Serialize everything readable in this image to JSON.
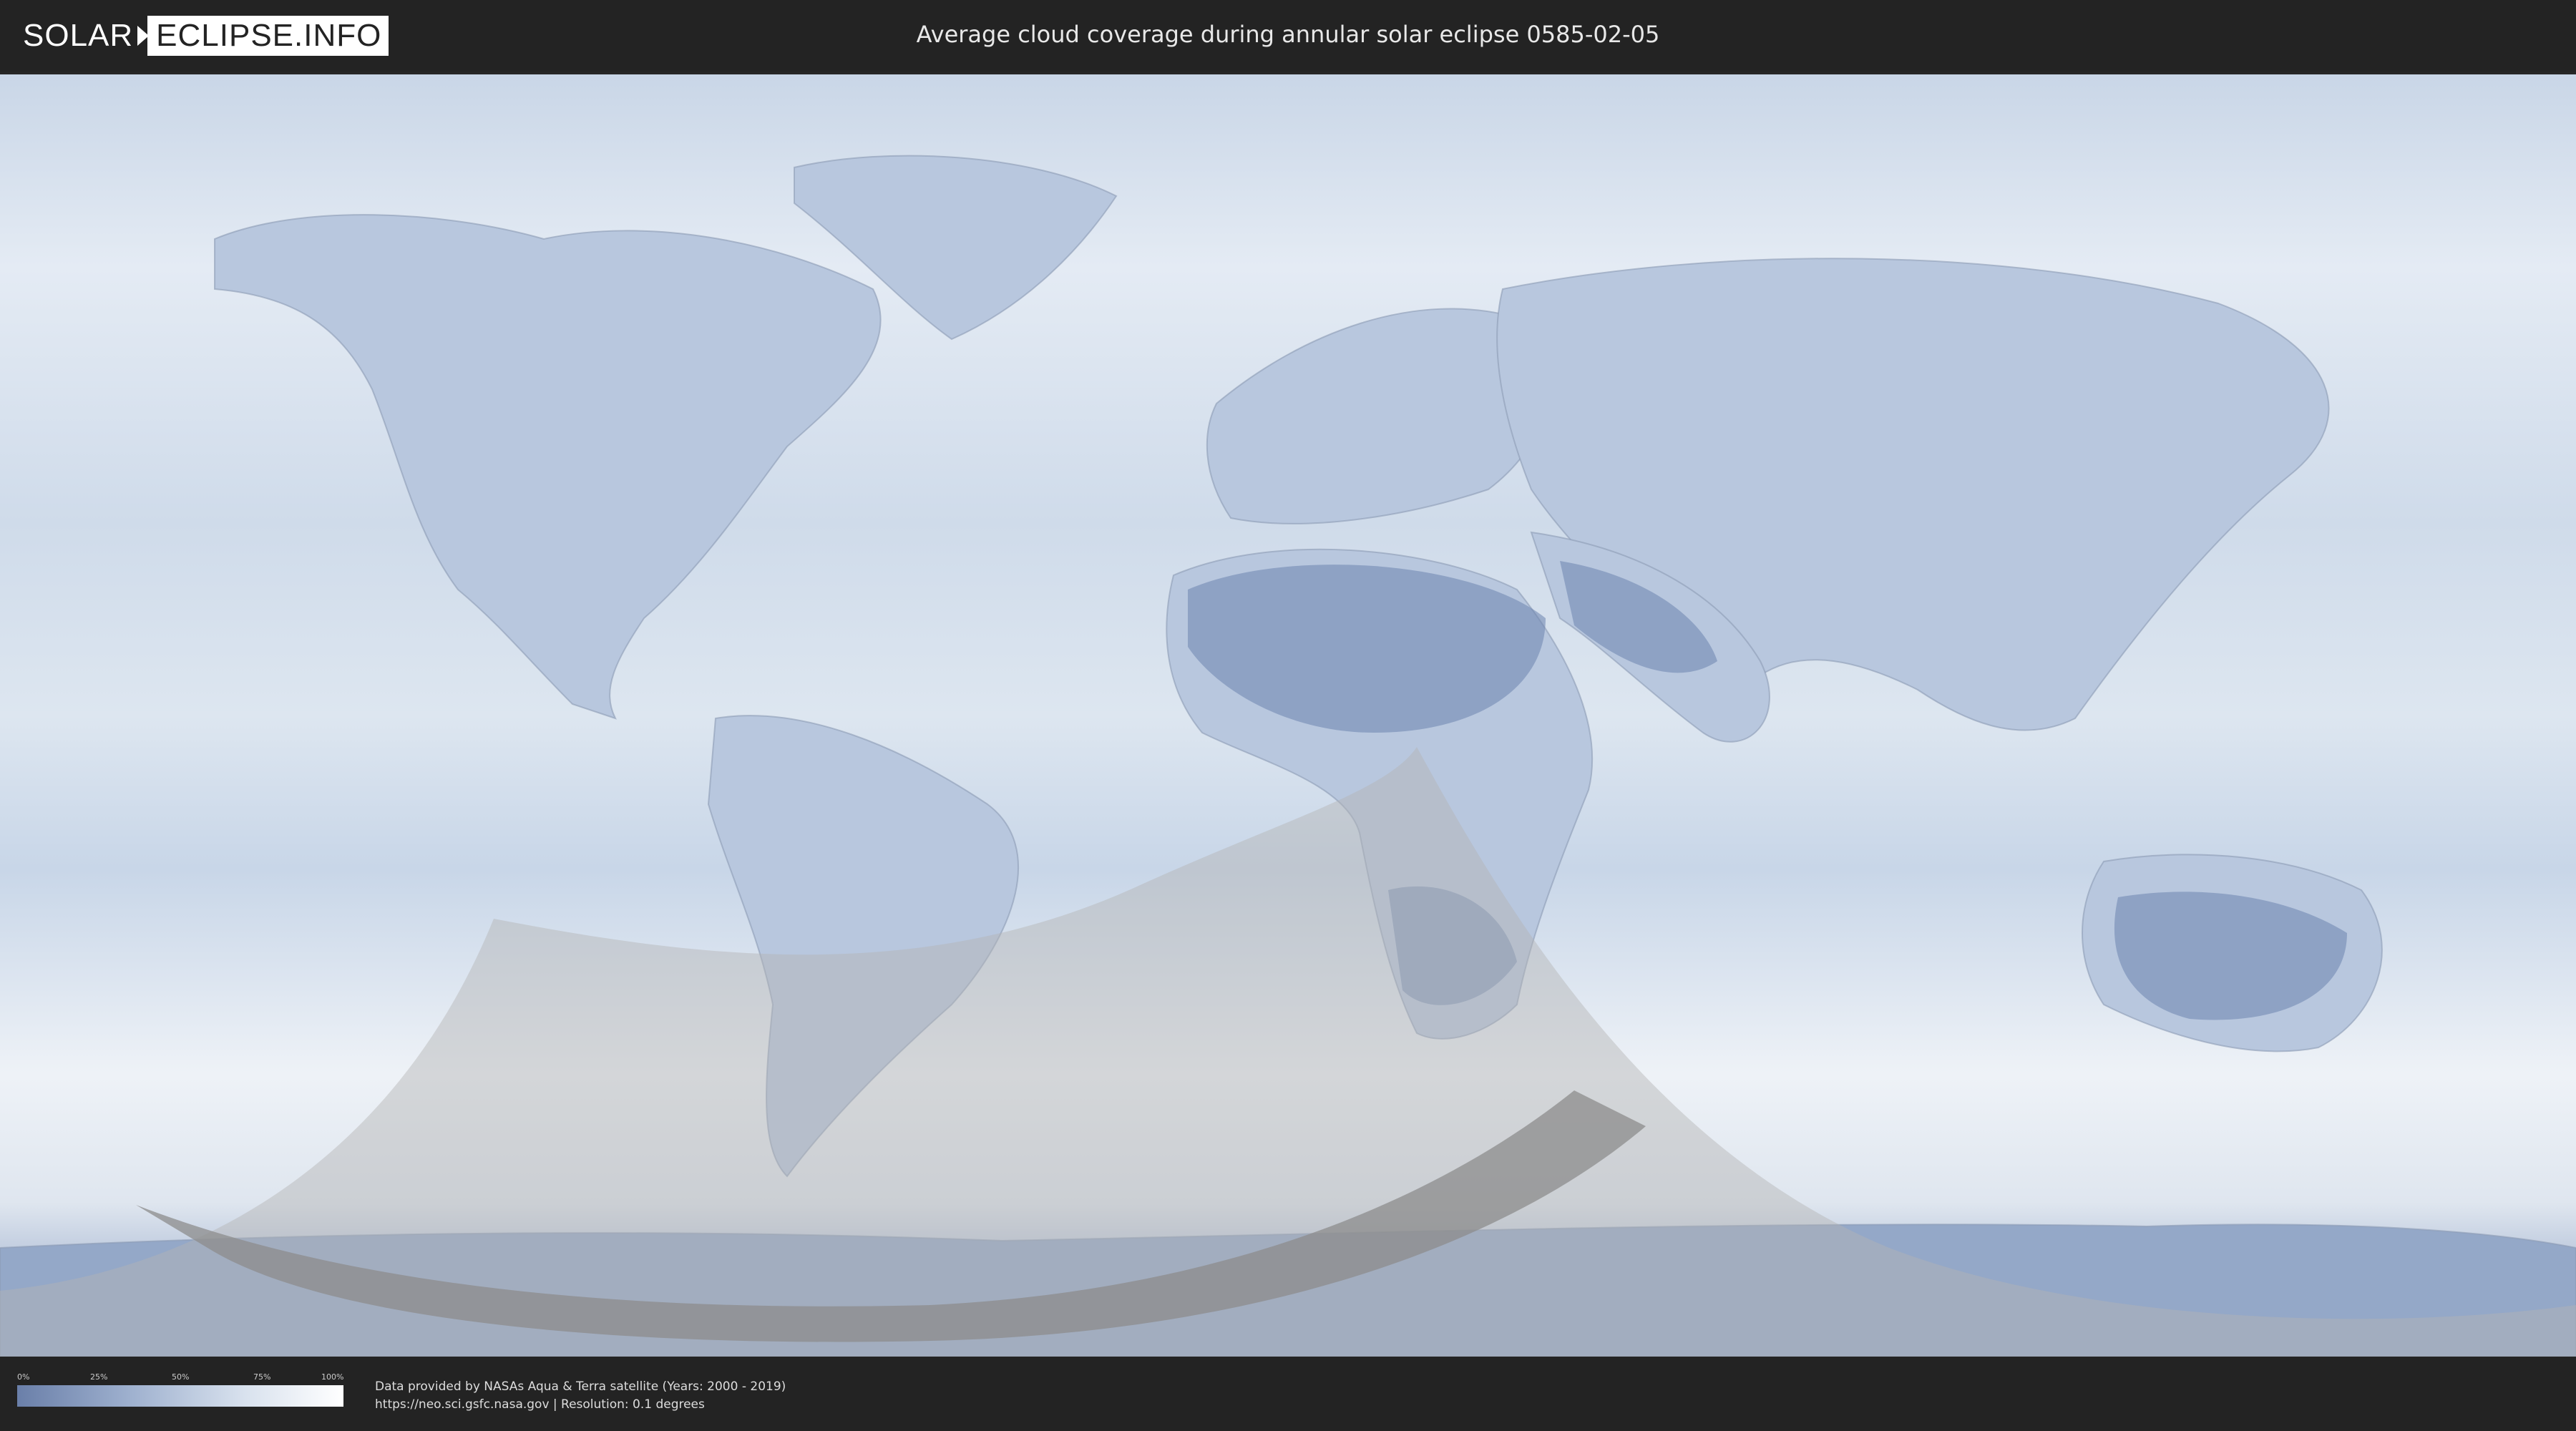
{
  "header": {
    "logo_part1": "SOLAR",
    "logo_part2": "ECLIPSE.INFO",
    "title": "Average cloud coverage during annular solar eclipse 0585-02-05"
  },
  "legend": {
    "ticks": [
      "0%",
      "25%",
      "50%",
      "75%",
      "100%"
    ],
    "colors": {
      "low": "#6a7fa9",
      "high": "#ffffff"
    }
  },
  "footer": {
    "line1": "Data provided by NASAs Aqua & Terra satellite (Years: 2000 - 2019)",
    "line2": "https://neo.sci.gsfc.nasa.gov | Resolution: 0.1 degrees"
  },
  "map": {
    "layers": [
      "cloud-coverage",
      "country-borders",
      "eclipse-visibility-zone",
      "annularity-path"
    ],
    "colors": {
      "ocean_cloudy": "#dfe7f1",
      "clear_sky": "#5f78a6",
      "shadow_zone": "#bcbcbc",
      "path": "#8c8c8c"
    }
  }
}
